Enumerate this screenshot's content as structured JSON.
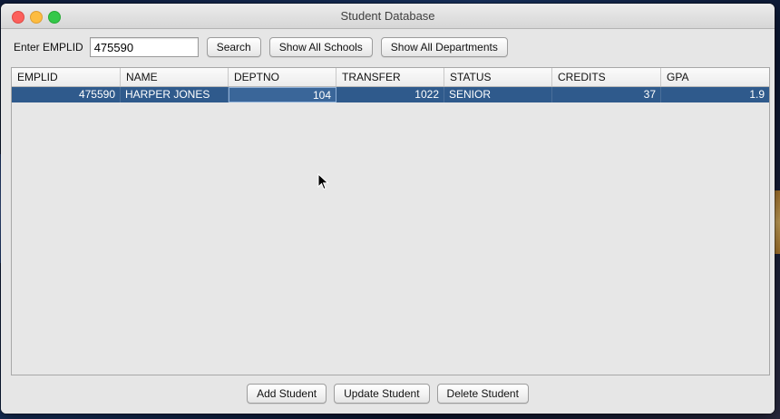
{
  "window": {
    "title": "Student Database"
  },
  "search": {
    "label": "Enter EMPLID",
    "value": "475590"
  },
  "toolbar": {
    "search_label": "Search",
    "show_schools_label": "Show All Schools",
    "show_departments_label": "Show All Departments"
  },
  "table": {
    "columns": [
      "EMPLID",
      "NAME",
      "DEPTNO",
      "TRANSFER",
      "STATUS",
      "CREDITS",
      "GPA"
    ],
    "rows": [
      {
        "emplid": "475590",
        "name": "HARPER JONES",
        "deptno": "104",
        "transfer": "1022",
        "status": "SENIOR",
        "credits": "37",
        "gpa": "1.9",
        "selected": true
      }
    ]
  },
  "actions": {
    "add_label": "Add Student",
    "update_label": "Update Student",
    "delete_label": "Delete Student"
  },
  "colors": {
    "selection": "#2f5a8c",
    "close": "#fc605c",
    "minimize": "#fdbc40",
    "maximize": "#34c84a"
  }
}
